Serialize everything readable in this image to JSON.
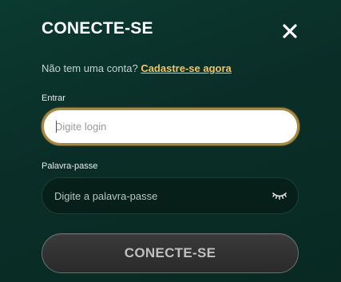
{
  "modal": {
    "title": "CONECTE-SE",
    "close_icon": "close-icon"
  },
  "signup": {
    "prompt": "Não tem uma conta?",
    "link": "Cadastre-se agora"
  },
  "login_field": {
    "label": "Entrar",
    "placeholder": "Digite login",
    "value": ""
  },
  "password_field": {
    "label": "Palavra-passe",
    "placeholder": "Digite a palavra-passe",
    "value": "",
    "toggle_icon": "eye-closed-icon"
  },
  "submit": {
    "label": "CONECTE-SE"
  },
  "colors": {
    "accent": "#f1c662",
    "focus_border": "#a58a45",
    "background": "#0a2e27"
  }
}
